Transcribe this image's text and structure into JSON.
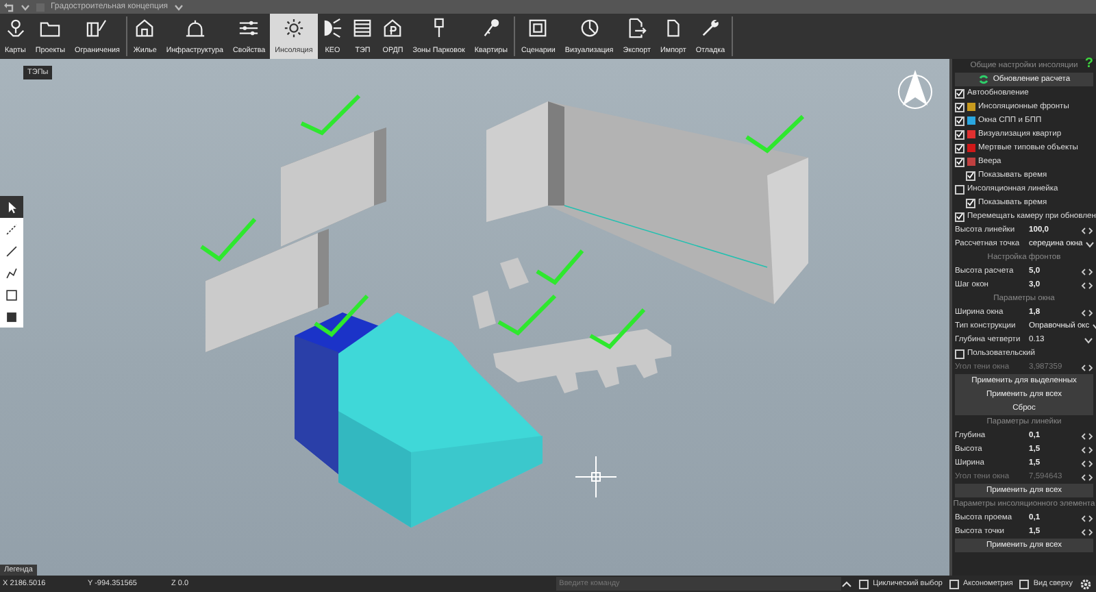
{
  "title_bar": {
    "title": "Градостроительная концепция"
  },
  "toolbar": [
    {
      "label": "Карты",
      "selected": false
    },
    {
      "label": "Проекты",
      "selected": false
    },
    {
      "label": "Ограничения",
      "selected": false,
      "separator_after": true
    },
    {
      "label": "Жилье",
      "selected": false
    },
    {
      "label": "Инфраструктура",
      "selected": false
    },
    {
      "label": "Свойства",
      "selected": false
    },
    {
      "label": "Инсоляция",
      "selected": true
    },
    {
      "label": "КЕО",
      "selected": false
    },
    {
      "label": "ТЭП",
      "selected": false
    },
    {
      "label": "ОРДП",
      "selected": false
    },
    {
      "label": "Зоны Парковок",
      "selected": false
    },
    {
      "label": "Квартиры",
      "selected": false,
      "separator_after": true
    },
    {
      "label": "Сценарии",
      "selected": false
    },
    {
      "label": "Визуализация",
      "selected": false
    },
    {
      "label": "Экспорт",
      "selected": false
    },
    {
      "label": "Импорт",
      "selected": false
    },
    {
      "label": "Отладка",
      "selected": false,
      "separator_after": true
    }
  ],
  "viewport": {
    "tooltip": "ТЭПы",
    "legend": "Легенда",
    "tools": [
      {
        "kind": "select",
        "selected": true
      },
      {
        "kind": "dashed-line",
        "selected": false
      },
      {
        "kind": "line",
        "selected": false
      },
      {
        "kind": "polyline",
        "selected": false
      },
      {
        "kind": "rectangle",
        "selected": false
      },
      {
        "kind": "filled-square",
        "selected": false
      }
    ]
  },
  "panel": {
    "help": "?",
    "rows": [
      {
        "kind": "header",
        "text": "Общие настройки инсоляции"
      },
      {
        "kind": "refresh-button",
        "text": "Обновление расчета"
      },
      {
        "kind": "check",
        "text": "Автообновление",
        "checked": true
      },
      {
        "kind": "check",
        "text": "Инсоляционные фронты",
        "checked": true,
        "color": "#c89a1e"
      },
      {
        "kind": "check",
        "text": "Окна СПП и БПП",
        "checked": true,
        "color": "#2aa7e0"
      },
      {
        "kind": "check",
        "text": "Визуализация квартир",
        "checked": true,
        "color": "#e03030"
      },
      {
        "kind": "check",
        "text": "Мертвые типовые объекты",
        "checked": true,
        "color": "#d01818"
      },
      {
        "kind": "check",
        "text": "Веера",
        "checked": true,
        "color": "#c04040",
        "children": [
          {
            "kind": "check",
            "text": "Показывать время",
            "checked": true
          }
        ]
      },
      {
        "kind": "check",
        "text": "Инсоляционная линейка",
        "checked": false,
        "children": [
          {
            "kind": "check",
            "text": "Показывать время",
            "checked": true
          }
        ]
      },
      {
        "kind": "check",
        "text": "Перемещать камеру при обновлен",
        "checked": true
      },
      {
        "kind": "field",
        "text": "Высота линейки",
        "value": "100,0",
        "disabled": false
      },
      {
        "kind": "select",
        "text": "Рассчетная точка",
        "value": "середина окна"
      },
      {
        "kind": "header",
        "text": "Настройка фронтов"
      },
      {
        "kind": "field",
        "text": "Высота расчета",
        "value": "5,0",
        "disabled": false
      },
      {
        "kind": "field",
        "text": "Шаг окон",
        "value": "3,0",
        "disabled": false
      },
      {
        "kind": "header",
        "text": "Параметры окна"
      },
      {
        "kind": "field",
        "text": "Ширина окна",
        "value": "1,8",
        "disabled": false
      },
      {
        "kind": "select",
        "text": "Тип конструкции",
        "value": "Оправочный окс"
      },
      {
        "kind": "select",
        "text": "Глубина четверти",
        "value": "0.13"
      },
      {
        "kind": "check",
        "text": "Пользовательский",
        "checked": false
      },
      {
        "kind": "field",
        "text": "Угол тени окна",
        "value": "3,987359",
        "disabled": true
      },
      {
        "kind": "button",
        "text": "Применить для выделенных"
      },
      {
        "kind": "button",
        "text": "Применить для всех"
      },
      {
        "kind": "button",
        "text": "Сброс"
      },
      {
        "kind": "header",
        "text": "Параметры линейки"
      },
      {
        "kind": "field",
        "text": "Глубина",
        "value": "0,1",
        "disabled": false
      },
      {
        "kind": "field",
        "text": "Высота",
        "value": "1,5",
        "disabled": false
      },
      {
        "kind": "field",
        "text": "Ширина",
        "value": "1,5",
        "disabled": false
      },
      {
        "kind": "field",
        "text": "Угол тени окна",
        "value": "7,594643",
        "disabled": true
      },
      {
        "kind": "button",
        "text": "Применить для всех"
      },
      {
        "kind": "header",
        "text": "Параметры инсоляционного элемента"
      },
      {
        "kind": "field",
        "text": "Высота проема",
        "value": "0,1",
        "disabled": false
      },
      {
        "kind": "field",
        "text": "Высота точки",
        "value": "1,5",
        "disabled": false
      },
      {
        "kind": "button",
        "text": "Применить для всех"
      }
    ]
  },
  "status_bar": {
    "x": "X 2186.5016",
    "y": "Y -994.351565",
    "z": "Z 0.0",
    "command_placeholder": "Введите команду",
    "options": [
      {
        "label": "Циклический выбор",
        "checked": false
      },
      {
        "label": "Аксонометрия",
        "checked": false
      },
      {
        "label": "Вид сверху",
        "checked": false
      }
    ]
  }
}
